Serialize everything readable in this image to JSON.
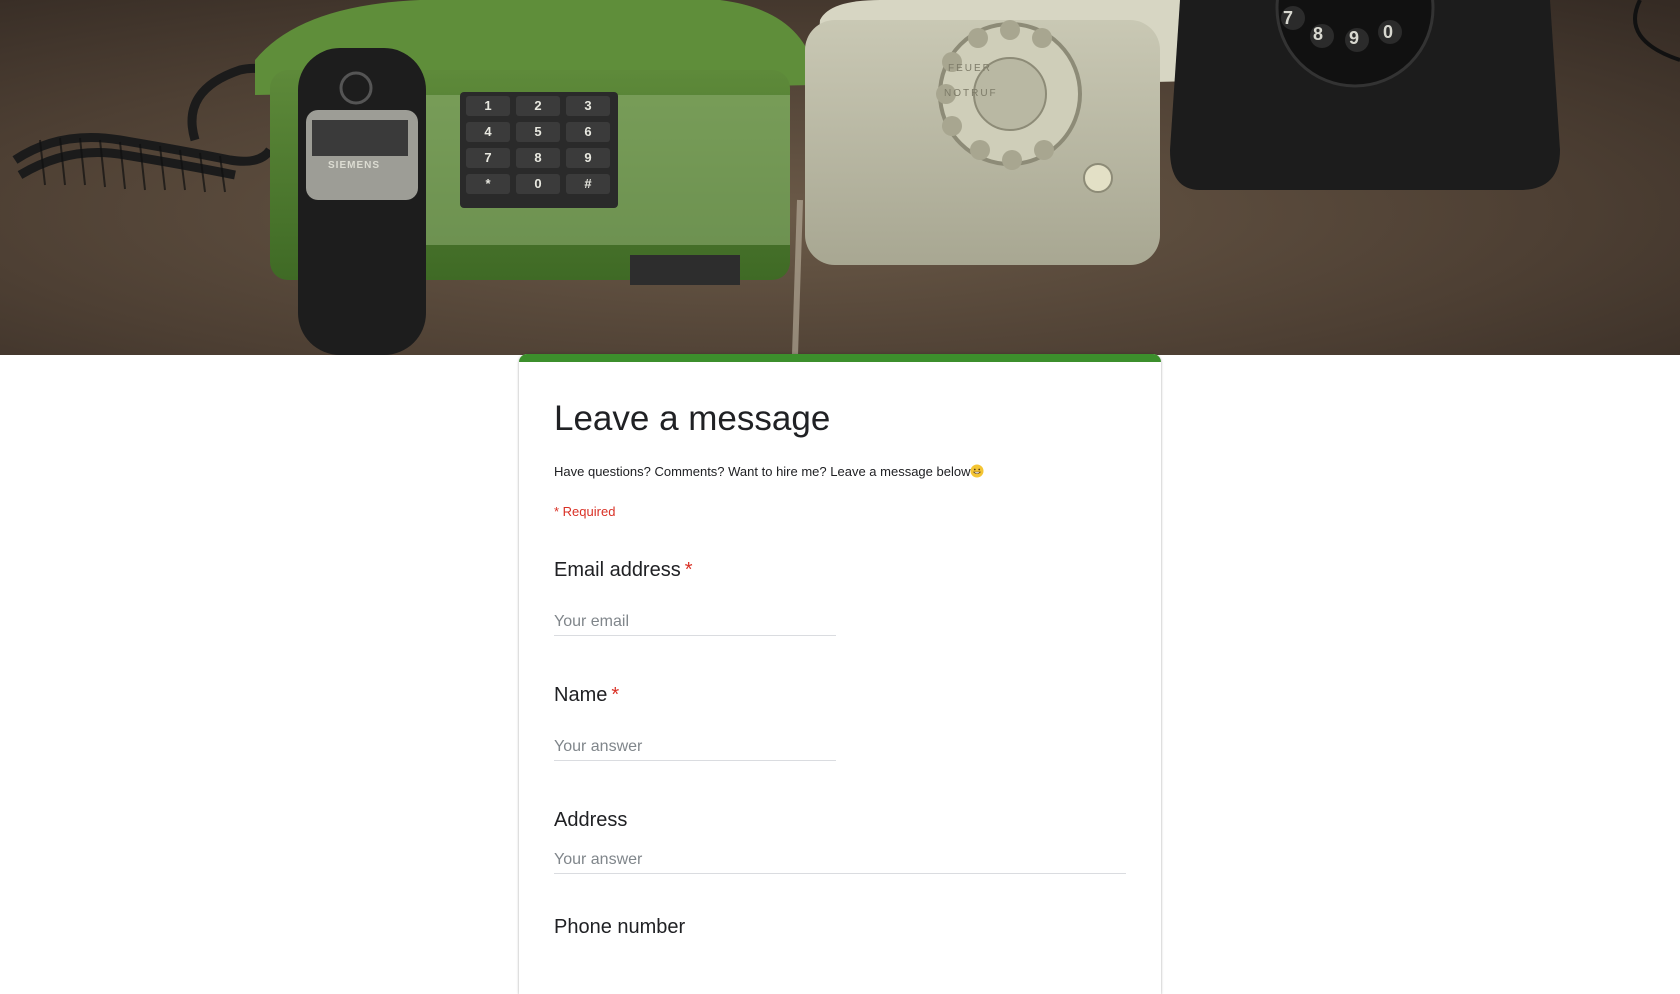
{
  "form": {
    "title": "Leave a message",
    "description": "Have questions? Comments? Want to hire me? Leave a message below",
    "description_emoji": "grinning-face-icon",
    "required_note": "* Required",
    "accent_color": "#3c8f2c",
    "questions": [
      {
        "label": "Email address",
        "required": true,
        "required_mark": "*",
        "placeholder": "Your email"
      },
      {
        "label": "Name",
        "required": true,
        "required_mark": "*",
        "placeholder": "Your answer"
      },
      {
        "label": "Address",
        "required": false,
        "placeholder": "Your answer"
      },
      {
        "label": "Phone number",
        "required": false
      }
    ]
  },
  "banner": {
    "image": "vintage-telephones-photo",
    "handset_brand": "SIEMENS",
    "dial_text_top": "FEUER",
    "dial_text_bottom": "NOTRUF",
    "keypad_keys": [
      "1",
      "2",
      "3",
      "4",
      "5",
      "6",
      "7",
      "8",
      "9",
      "*",
      "0",
      "#"
    ],
    "dial_digits_visible": [
      "7",
      "8",
      "9",
      "0"
    ]
  }
}
